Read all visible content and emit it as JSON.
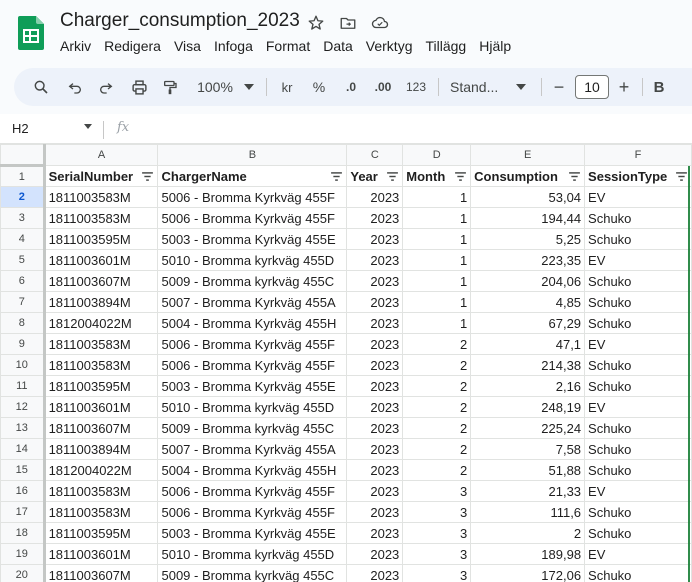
{
  "app": {
    "title": "Charger_consumption_2023",
    "menu": [
      "Arkiv",
      "Redigera",
      "Visa",
      "Infoga",
      "Format",
      "Data",
      "Verktyg",
      "Tillägg",
      "Hjälp"
    ]
  },
  "toolbar": {
    "zoom": "100%",
    "currency": "kr",
    "percent": "%",
    "dec_decrease": ".0",
    "dec_increase": ".00",
    "number_format": "123",
    "font": "Stand...",
    "font_size": "10",
    "minus": "−",
    "plus": "+",
    "bold": "B"
  },
  "formula_bar": {
    "name_box": "H2",
    "fx": "fx"
  },
  "grid": {
    "columns": [
      "A",
      "B",
      "C",
      "D",
      "E",
      "F"
    ],
    "headers": [
      "SerialNumber",
      "ChargerName",
      "Year",
      "Month",
      "Consumption",
      "SessionType"
    ],
    "rows": [
      [
        "1811003583M",
        "5006 - Bromma Kyrkväg 455F",
        "2023",
        "1",
        "53,04",
        "EV"
      ],
      [
        "1811003583M",
        "5006 - Bromma Kyrkväg 455F",
        "2023",
        "1",
        "194,44",
        "Schuko"
      ],
      [
        "1811003595M",
        "5003 - Bromma Kyrkväg 455E",
        "2023",
        "1",
        "5,25",
        "Schuko"
      ],
      [
        "1811003601M",
        "5010 - Bromma kyrkväg 455D",
        "2023",
        "1",
        "223,35",
        "EV"
      ],
      [
        "1811003607M",
        "5009 - Bromma kyrkväg 455C",
        "2023",
        "1",
        "204,06",
        "Schuko"
      ],
      [
        "1811003894M",
        "5007 - Bromma Kyrkväg 455A",
        "2023",
        "1",
        "4,85",
        "Schuko"
      ],
      [
        "1812004022M",
        "5004 - Bromma Kyrkväg 455H",
        "2023",
        "1",
        "67,29",
        "Schuko"
      ],
      [
        "1811003583M",
        "5006 - Bromma Kyrkväg 455F",
        "2023",
        "2",
        "47,1",
        "EV"
      ],
      [
        "1811003583M",
        "5006 - Bromma Kyrkväg 455F",
        "2023",
        "2",
        "214,38",
        "Schuko"
      ],
      [
        "1811003595M",
        "5003 - Bromma Kyrkväg 455E",
        "2023",
        "2",
        "2,16",
        "Schuko"
      ],
      [
        "1811003601M",
        "5010 - Bromma kyrkväg 455D",
        "2023",
        "2",
        "248,19",
        "EV"
      ],
      [
        "1811003607M",
        "5009 - Bromma kyrkväg 455C",
        "2023",
        "2",
        "225,24",
        "Schuko"
      ],
      [
        "1811003894M",
        "5007 - Bromma Kyrkväg 455A",
        "2023",
        "2",
        "7,58",
        "Schuko"
      ],
      [
        "1812004022M",
        "5004 - Bromma Kyrkväg 455H",
        "2023",
        "2",
        "51,88",
        "Schuko"
      ],
      [
        "1811003583M",
        "5006 - Bromma Kyrkväg 455F",
        "2023",
        "3",
        "21,33",
        "EV"
      ],
      [
        "1811003583M",
        "5006 - Bromma Kyrkväg 455F",
        "2023",
        "3",
        "111,6",
        "Schuko"
      ],
      [
        "1811003595M",
        "5003 - Bromma Kyrkväg 455E",
        "2023",
        "3",
        "2",
        "Schuko"
      ],
      [
        "1811003601M",
        "5010 - Bromma kyrkväg 455D",
        "2023",
        "3",
        "189,98",
        "EV"
      ],
      [
        "1811003607M",
        "5009 - Bromma kyrkväg 455C",
        "2023",
        "3",
        "172,06",
        "Schuko"
      ]
    ]
  },
  "colors": {
    "accent": "#0b57d0",
    "sheets_green": "#0f9d58",
    "toolbar_bg": "#edf2fa"
  }
}
